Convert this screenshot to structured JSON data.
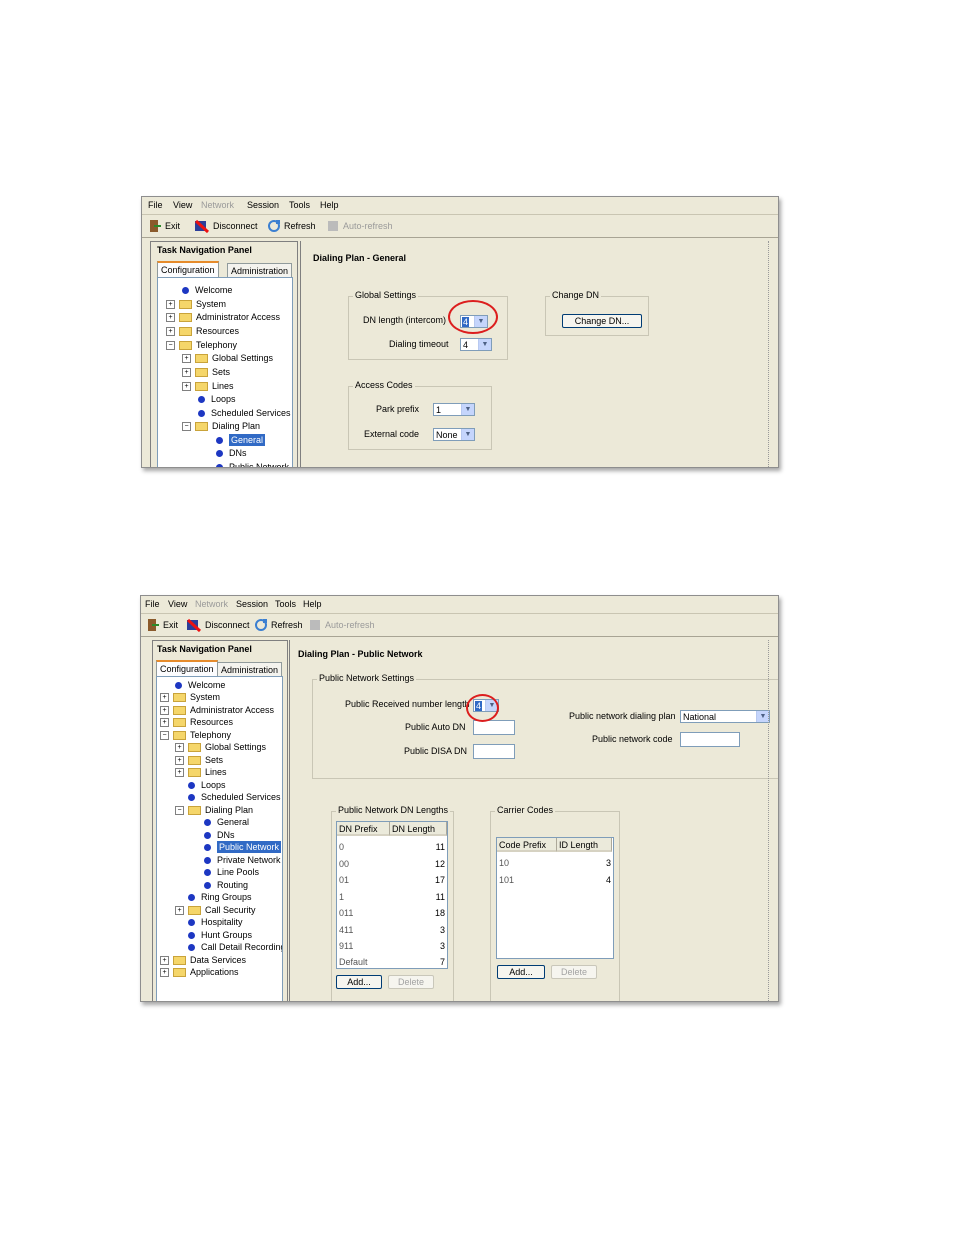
{
  "menu": {
    "file": "File",
    "view": "View",
    "network": "Network",
    "session": "Session",
    "tools": "Tools",
    "help": "Help"
  },
  "toolbar": {
    "exit": "Exit",
    "disconnect": "Disconnect",
    "refresh": "Refresh",
    "auto_refresh": "Auto-refresh"
  },
  "nav": {
    "header": "Task Navigation Panel",
    "tab_config": "Configuration",
    "tab_admin": "Administration"
  },
  "tree": {
    "welcome": "Welcome",
    "system": "System",
    "admin_access": "Administrator Access",
    "resources": "Resources",
    "telephony": "Telephony",
    "global_settings": "Global Settings",
    "sets": "Sets",
    "lines": "Lines",
    "loops": "Loops",
    "scheduled_services": "Scheduled Services",
    "dialing_plan": "Dialing Plan",
    "general": "General",
    "dns": "DNs",
    "public_network": "Public Network",
    "private_network": "Private Network",
    "line_pools": "Line Pools",
    "routing": "Routing",
    "ring_groups": "Ring Groups",
    "call_security": "Call Security",
    "hospitality": "Hospitality",
    "hunt_groups": "Hunt Groups",
    "cdr": "Call Detail Recording",
    "data_services": "Data Services",
    "applications": "Applications"
  },
  "panel1": {
    "title": "Dialing Plan - General",
    "global_settings": "Global Settings",
    "dn_length_label": "DN length (intercom)",
    "dn_length_value": "4",
    "dialing_timeout_label": "Dialing timeout",
    "dialing_timeout_value": "4",
    "change_dn_group": "Change DN",
    "change_dn_button": "Change DN...",
    "access_codes": "Access Codes",
    "park_prefix_label": "Park prefix",
    "park_prefix_value": "1",
    "external_code_label": "External code",
    "external_code_value": "None"
  },
  "panel2": {
    "title": "Dialing Plan - Public Network",
    "settings_group": "Public Network Settings",
    "received_len_label": "Public Received number length",
    "received_len_value": "4",
    "auto_dn_label": "Public Auto DN",
    "disa_dn_label": "Public DISA DN",
    "dialing_plan_label": "Public network dialing plan",
    "dialing_plan_value": "National",
    "network_code_label": "Public network code",
    "dn_lengths_group": "Public Network DN Lengths",
    "dn_lengths_headers": [
      "DN Prefix",
      "DN Length"
    ],
    "dn_lengths_rows": [
      {
        "prefix": "0",
        "length": "11"
      },
      {
        "prefix": "00",
        "length": "12"
      },
      {
        "prefix": "01",
        "length": "17"
      },
      {
        "prefix": "1",
        "length": "11"
      },
      {
        "prefix": "011",
        "length": "18"
      },
      {
        "prefix": "411",
        "length": "3"
      },
      {
        "prefix": "911",
        "length": "3"
      },
      {
        "prefix": "Default",
        "length": "7"
      }
    ],
    "carrier_group": "Carrier Codes",
    "carrier_headers": [
      "Code Prefix",
      "ID Length"
    ],
    "carrier_rows": [
      {
        "prefix": "10",
        "length": "3"
      },
      {
        "prefix": "101",
        "length": "4"
      }
    ],
    "add_label": "Add...",
    "delete_label": "Delete"
  },
  "colors": {
    "highlight": "#dc1e1e",
    "selection": "#316ac5",
    "window": "#ece9d8"
  }
}
